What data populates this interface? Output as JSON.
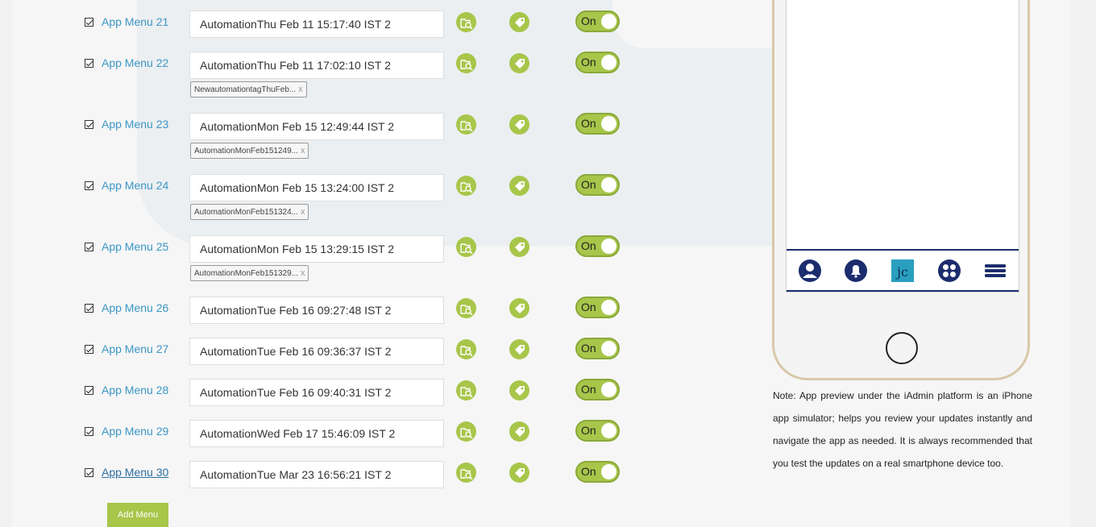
{
  "menus": [
    {
      "label": "App Menu 21",
      "value": "AutomationThu Feb 11 15:17:40 IST 2",
      "tag": null,
      "toggle": "On"
    },
    {
      "label": "App Menu 22",
      "value": "AutomationThu Feb 11 17:02:10 IST 2",
      "tag": "NewautomationtagThuFeb...",
      "toggle": "On"
    },
    {
      "label": "App Menu 23",
      "value": "AutomationMon Feb 15 12:49:44 IST 2",
      "tag": "AutomationMonFeb151249...",
      "toggle": "On"
    },
    {
      "label": "App Menu 24",
      "value": "AutomationMon Feb 15 13:24:00 IST 2",
      "tag": "AutomationMonFeb151324...",
      "toggle": "On"
    },
    {
      "label": "App Menu 25",
      "value": "AutomationMon Feb 15 13:29:15 IST 2",
      "tag": "AutomationMonFeb151329...",
      "toggle": "On"
    },
    {
      "label": "App Menu 26",
      "value": "AutomationTue Feb 16 09:27:48 IST 2",
      "tag": null,
      "toggle": "On"
    },
    {
      "label": "App Menu 27",
      "value": "AutomationTue Feb 16 09:36:37 IST 2",
      "tag": null,
      "toggle": "On"
    },
    {
      "label": "App Menu 28",
      "value": "AutomationTue Feb 16 09:40:31 IST 2",
      "tag": null,
      "toggle": "On"
    },
    {
      "label": "App Menu 29",
      "value": "AutomationWed Feb 17 15:46:09 IST 2",
      "tag": null,
      "toggle": "On"
    },
    {
      "label": "App Menu 30",
      "value": "AutomationTue Mar 23 16:56:21 IST 2",
      "tag": null,
      "toggle": "On"
    }
  ],
  "chip_close": "x",
  "add_menu_label": "Add Menu",
  "phone": {
    "tab_icons": [
      "user-profile-icon",
      "bell-icon",
      "app-logo-icon",
      "grid-dots-icon",
      "hamburger-menu-icon"
    ],
    "note": "Note: App preview under the iAdmin platform is an iPhone app simulator; helps you review your updates instantly and navigate the app as needed. It is always recommended that you test the updates on a real smartphone device too."
  },
  "colors": {
    "accent_green": "#a7c64a",
    "link_blue": "#3b96c6",
    "tab_navy": "#1c2d6e"
  }
}
